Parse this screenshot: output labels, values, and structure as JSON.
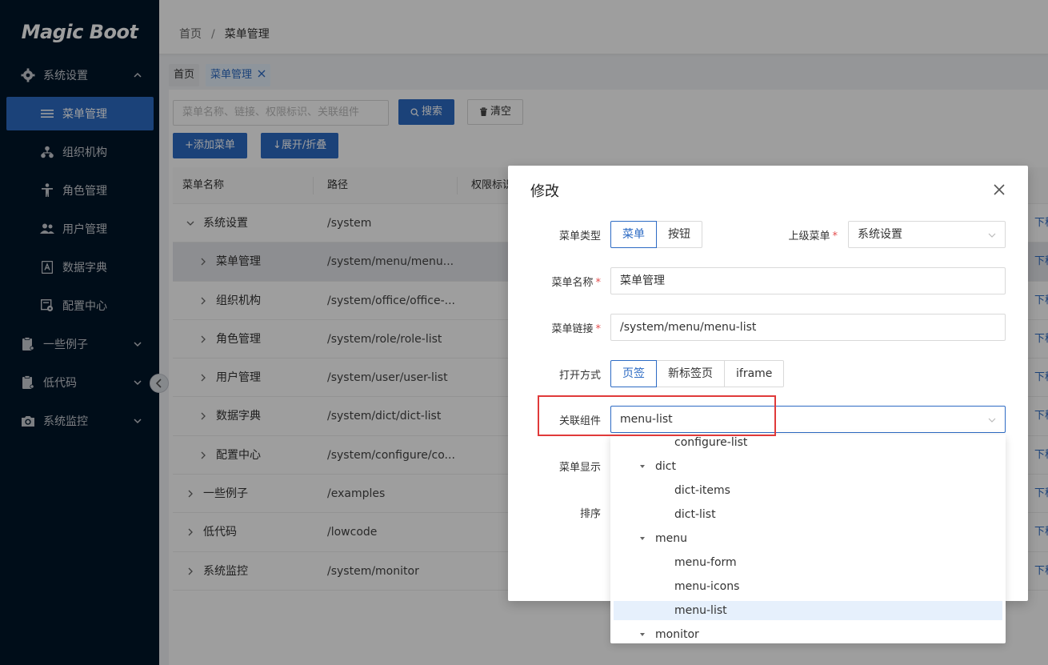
{
  "sidebar": {
    "logo": "Magic Boot",
    "items": [
      {
        "label": "系统设置",
        "icon": "gear-icon"
      },
      {
        "label": "菜单管理",
        "icon": "list-icon"
      },
      {
        "label": "组织机构",
        "icon": "org-icon"
      },
      {
        "label": "角色管理",
        "icon": "person-icon"
      },
      {
        "label": "用户管理",
        "icon": "users-icon"
      },
      {
        "label": "数据字典",
        "icon": "dictionary-icon"
      },
      {
        "label": "配置中心",
        "icon": "config-icon"
      },
      {
        "label": "一些例子",
        "icon": "clipboard-icon"
      },
      {
        "label": "低代码",
        "icon": "clipboard-icon"
      },
      {
        "label": "系统监控",
        "icon": "camera-icon"
      }
    ]
  },
  "header": {
    "breadcrumb": [
      "首页",
      "菜单管理"
    ],
    "breadcrumb_sep": "/"
  },
  "tags": [
    {
      "label": "首页"
    },
    {
      "label": "菜单管理"
    }
  ],
  "toolbar": {
    "search_placeholder": "菜单名称、链接、权限标识、关联组件",
    "search_button": "搜索",
    "clear_button": "清空",
    "add_button": "+添加菜单",
    "expand_button": "↓展开/折叠"
  },
  "table": {
    "columns": [
      "菜单名称",
      "路径",
      "权限标识"
    ],
    "rows": [
      {
        "name": "系统设置",
        "path": "/system",
        "action": "下移"
      },
      {
        "name": "菜单管理",
        "path": "/system/menu/menu...",
        "action": "下移"
      },
      {
        "name": "组织机构",
        "path": "/system/office/office-...",
        "action": "下移"
      },
      {
        "name": "角色管理",
        "path": "/system/role/role-list",
        "action": "下移"
      },
      {
        "name": "用户管理",
        "path": "/system/user/user-list",
        "action": "下移"
      },
      {
        "name": "数据字典",
        "path": "/system/dict/dict-list",
        "action": "下移"
      },
      {
        "name": "配置中心",
        "path": "/system/configure/co...",
        "action": "下移"
      },
      {
        "name": "一些例子",
        "path": "/examples",
        "action": "下移"
      },
      {
        "name": "低代码",
        "path": "/lowcode",
        "action": "下移"
      },
      {
        "name": "系统监控",
        "path": "/system/monitor",
        "action": "下移"
      }
    ]
  },
  "modal": {
    "title": "修改",
    "menu_type_label": "菜单类型",
    "menu_type_options": [
      "菜单",
      "按钮"
    ],
    "parent_label": "上级菜单",
    "parent_value": "系统设置",
    "name_label": "菜单名称",
    "name_value": "菜单管理",
    "link_label": "菜单链接",
    "link_value": "/system/menu/menu-list",
    "open_label": "打开方式",
    "open_options": [
      "页签",
      "新标签页",
      "iframe"
    ],
    "component_label": "关联组件",
    "component_value": "menu-list",
    "display_label": "菜单显示",
    "sort_label": "排序"
  },
  "dropdown": {
    "items": [
      "configure-list",
      "dict",
      "dict-items",
      "dict-list",
      "menu",
      "menu-form",
      "menu-icons",
      "menu-list",
      "monitor"
    ]
  },
  "colors": {
    "sidebar_bg": "#001529",
    "accent": "#2d6bc4",
    "highlight_box": "#e03a3a"
  }
}
